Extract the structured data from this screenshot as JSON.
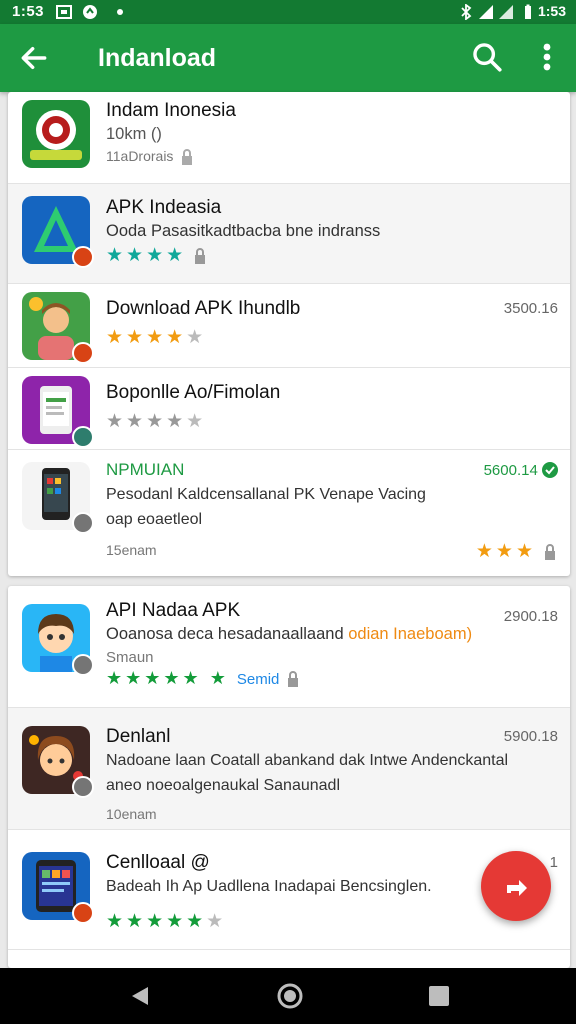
{
  "status_bar": {
    "time": "1:53",
    "right_text": "1:53"
  },
  "app_bar": {
    "title": "Indanload"
  },
  "colors": {
    "app_bar": "#1e9a43",
    "status_bar": "#137a32",
    "star_teal": "#10a89a",
    "star_orange": "#f29c11",
    "star_gray": "#999999",
    "star_green": "#139c3a",
    "fab": "#e53935"
  },
  "list1": [
    {
      "title": "Indam Inonesia",
      "line2": "10km ()",
      "line3": "11aDrorais",
      "icon": "app-logo-seal-icon"
    },
    {
      "title": "APK Indeasia",
      "line2": "Ooda Pasasitkadtbacba bne indranss",
      "stars": "★★★★",
      "icon": "triangle-logo-icon"
    },
    {
      "title": "Download APK Ihundlb",
      "price": "3500.16",
      "stars": "★★★★",
      "icon": "character-avatar-icon"
    },
    {
      "title": "Boponlle Ao/Fimolan",
      "stars": "★★★★",
      "icon": "phone-purple-icon"
    },
    {
      "title": "NPMUIAN",
      "price": "5600.14",
      "line2": "Pesodanl Kaldcensallanal PK Venape Vacing",
      "line2b": "oap eoaetleol",
      "line3": "15enam",
      "stars": "★★★",
      "icon": "smartphone-icon"
    }
  ],
  "list2": [
    {
      "title": "API Nadaa APK",
      "price": "2900.18",
      "line2": "Ooanosa deca hesadanaallaand",
      "line2_orange": "odian Inaeboam)",
      "line3": "Smaun",
      "stars": "★★★★★",
      "extra_star": "★",
      "extra_label": "Semid",
      "icon": "boy-avatar-icon"
    },
    {
      "title": "Denlanl",
      "price": "5900.18",
      "line2": "Nadoane laan Coatall abankand dak Intwe Andenckantal",
      "line2b": "aneo noeoalgenaukal Sanaunadl",
      "line3": "10enam",
      "icon": "girl-avatar-icon"
    },
    {
      "title": "Cenlloaal @",
      "price": "1",
      "line2": "Badeah Ih Ap Uadllena Inadapai Bencsinglen.",
      "stars": "★★★★★",
      "icon": "tablet-blue-icon"
    }
  ]
}
